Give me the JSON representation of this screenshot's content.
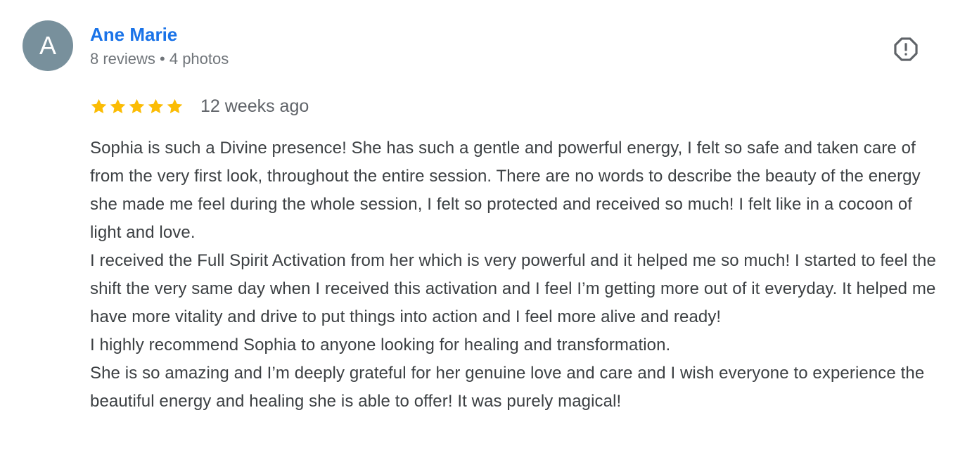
{
  "author": {
    "avatar_letter": "A",
    "avatar_color": "#78909c",
    "name": "Ane Marie",
    "meta": "8 reviews • 4 photos",
    "name_color": "#1a73e8"
  },
  "report": {
    "icon": "report-flag-icon"
  },
  "rating": {
    "stars": 5,
    "max_stars": 5,
    "star_color": "#fbbc04",
    "date": "12 weeks ago"
  },
  "review": {
    "paragraphs": [
      "Sophia is such a Divine presence! She has such a gentle and powerful energy, I felt so safe and taken care of from the very first look, throughout the entire session. There are no words to describe the beauty of the energy she made me feel during the whole session, I felt so protected and received so much! I felt like in a cocoon of light and love.",
      "I received the Full Spirit Activation from her which is very powerful and it helped me so much! I started to feel the shift the very same day when I received this activation and I feel I’m getting more out of it everyday. It helped me have more vitality and drive to put things into action and I feel more alive and ready!",
      "I highly recommend Sophia to anyone looking for healing and transformation.",
      "She is so amazing and I’m deeply grateful for her genuine love and care and I wish everyone to experience the beautiful energy and healing she is able to offer! It was purely magical!"
    ]
  }
}
